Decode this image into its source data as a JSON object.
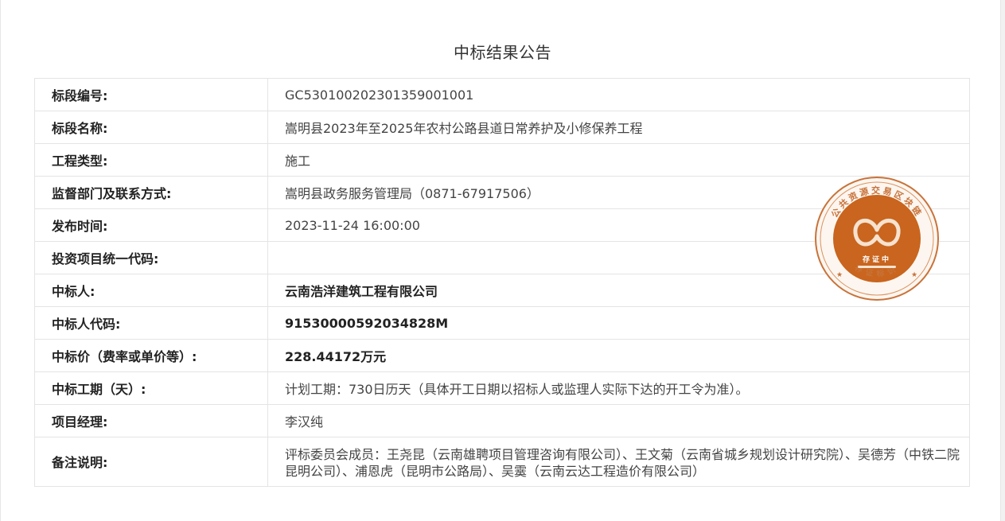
{
  "page": {
    "title": "中标结果公告"
  },
  "rows": [
    {
      "label": "标段编号:",
      "value": "GC5301002023013590010​01",
      "bold": false
    },
    {
      "label": "标段名称:",
      "value": "嵩明县2023年至2025年农村公路县道日常养护及小修保养工程",
      "bold": false
    },
    {
      "label": "工程类型:",
      "value": "施工",
      "bold": false
    },
    {
      "label": "监督部门及联系方式:",
      "value": "嵩明县政务服务管理局（0871-67917506）",
      "bold": false
    },
    {
      "label": "发布时间:",
      "value": "2023-11-24 16:00:00",
      "bold": false
    },
    {
      "label": "投资项目统一代码:",
      "value": "",
      "bold": false
    },
    {
      "label": "中标人:",
      "value": "云南浩洋建筑工程有限公司",
      "bold": true
    },
    {
      "label": "中标人代码:",
      "value": "91530000592034828M",
      "bold": true
    },
    {
      "label": "中标价（费率或单价等）:",
      "value": "228.44172万元",
      "bold": true
    },
    {
      "label": "中标工期（天）:",
      "value": "计划工期：730日历天（具体开工日期以招标人或监理人实际下达的开工令为准）。",
      "bold": false
    },
    {
      "label": "项目经理:",
      "value": "李汉纯",
      "bold": false
    },
    {
      "label": "备注说明:",
      "value": "评标委员会成员：王尧昆（云南雄聘项目管理咨询有限公司）、王文菊（云南省城乡规划设计研究院）、吴德芳（中铁二院昆明公司）、浦恩虎（昆明市公路局）、吴霙（云南云达工程造价有限公司）",
      "bold": false
    }
  ],
  "stamp": {
    "ring_text": "公共资源交易区块链",
    "center_text": "存证中",
    "bottom_text": "存证标识",
    "colors": {
      "outer": "#c8733a",
      "inner": "#c9651e",
      "ring": "#f7e9dc"
    }
  }
}
